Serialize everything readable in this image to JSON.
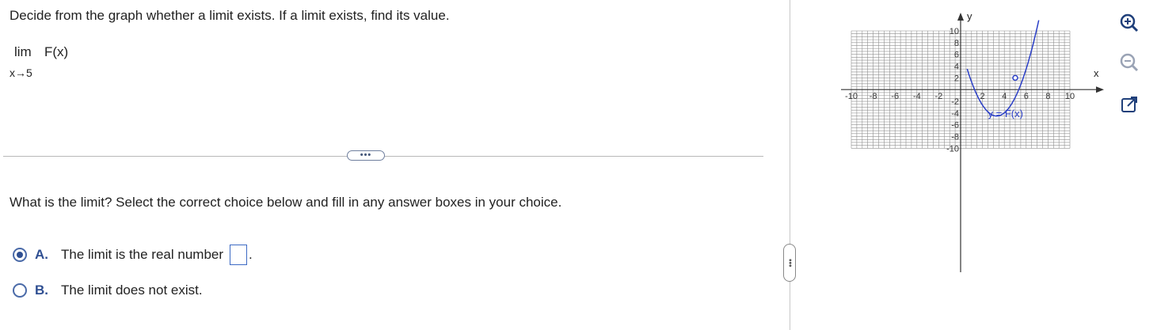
{
  "question": {
    "text": "Decide from the graph whether a limit exists. If a limit exists, find its value.",
    "limit_word": "lim",
    "function": "F(x)",
    "approach": "x→5"
  },
  "more_button": {
    "label": "•••"
  },
  "prompt": "What is the limit? Select the correct choice below and fill in any answer boxes in your choice.",
  "choices": [
    {
      "letter": "A.",
      "text": "The limit is the real number",
      "selected": true,
      "answer_value": "",
      "suffix": "."
    },
    {
      "letter": "B.",
      "text": "The limit does not exist.",
      "selected": false
    }
  ],
  "pane_handle": {
    "label": "•••"
  },
  "graph": {
    "x_axis_label": "x",
    "y_axis_label": "y",
    "x_ticks": [
      "-10",
      "-8",
      "-6",
      "-4",
      "-2",
      "2",
      "4",
      "6",
      "8",
      "10"
    ],
    "y_ticks": [
      "10",
      "8",
      "6",
      "4",
      "2",
      "-2",
      "-4",
      "-6",
      "-8",
      "-10"
    ],
    "curve_label": "y = F(x)",
    "open_point": {
      "x": 5,
      "y": 2
    }
  },
  "tools": [
    {
      "name": "zoom-in-icon"
    },
    {
      "name": "zoom-out-icon"
    },
    {
      "name": "popout-icon"
    }
  ],
  "colors": {
    "accent": "#2f4f92",
    "curve": "#2b3fc7",
    "grid": "#909090"
  }
}
